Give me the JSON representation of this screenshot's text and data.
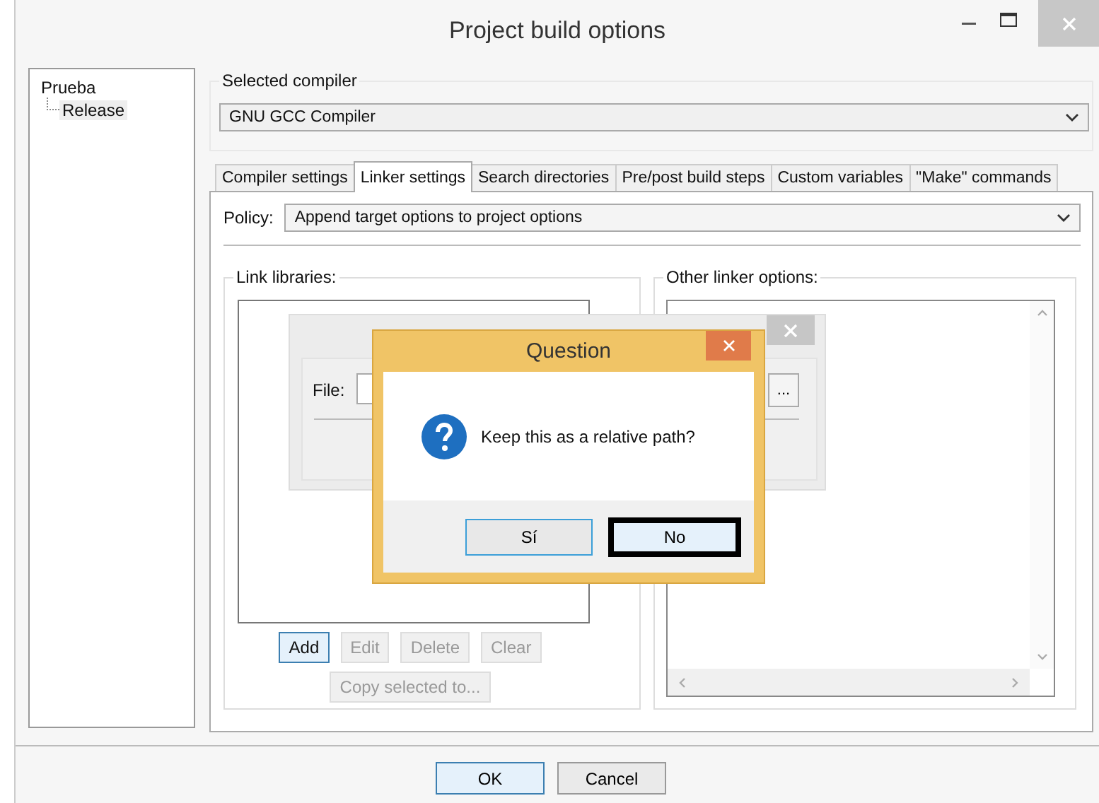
{
  "window": {
    "title": "Project build options"
  },
  "tree": [
    {
      "label": "Prueba",
      "selected": false,
      "children": [
        {
          "label": "Release",
          "selected": true
        }
      ]
    }
  ],
  "selected_compiler": {
    "label": "Selected compiler",
    "value": "GNU GCC Compiler"
  },
  "tabs": [
    {
      "label": "Compiler settings",
      "selected": false
    },
    {
      "label": "Linker settings",
      "selected": true
    },
    {
      "label": "Search directories",
      "selected": false
    },
    {
      "label": "Pre/post build steps",
      "selected": false
    },
    {
      "label": "Custom variables",
      "selected": false
    },
    {
      "label": "\"Make\" commands",
      "selected": false
    }
  ],
  "policy": {
    "label": "Policy:",
    "value": "Append target options to project options"
  },
  "link_libraries": {
    "label": "Link libraries:",
    "buttons": [
      {
        "label": "Add",
        "disabled": false
      },
      {
        "label": "Edit",
        "disabled": true
      },
      {
        "label": "Delete",
        "disabled": true
      },
      {
        "label": "Clear",
        "disabled": true
      }
    ],
    "copy_button": {
      "label": "Copy selected to...",
      "disabled": true
    }
  },
  "other_linker_options": {
    "label": "Other linker options:"
  },
  "background_dialog": {
    "file_label": "File:",
    "browse_button": "..."
  },
  "question_dialog": {
    "title": "Question",
    "message": "Keep this as a relative path?",
    "buttons": [
      {
        "label": "Sí",
        "selected": false
      },
      {
        "label": "No",
        "selected": true
      }
    ]
  },
  "buttons": [
    {
      "label": "OK",
      "selected": true
    },
    {
      "label": "Cancel",
      "selected": false
    }
  ]
}
